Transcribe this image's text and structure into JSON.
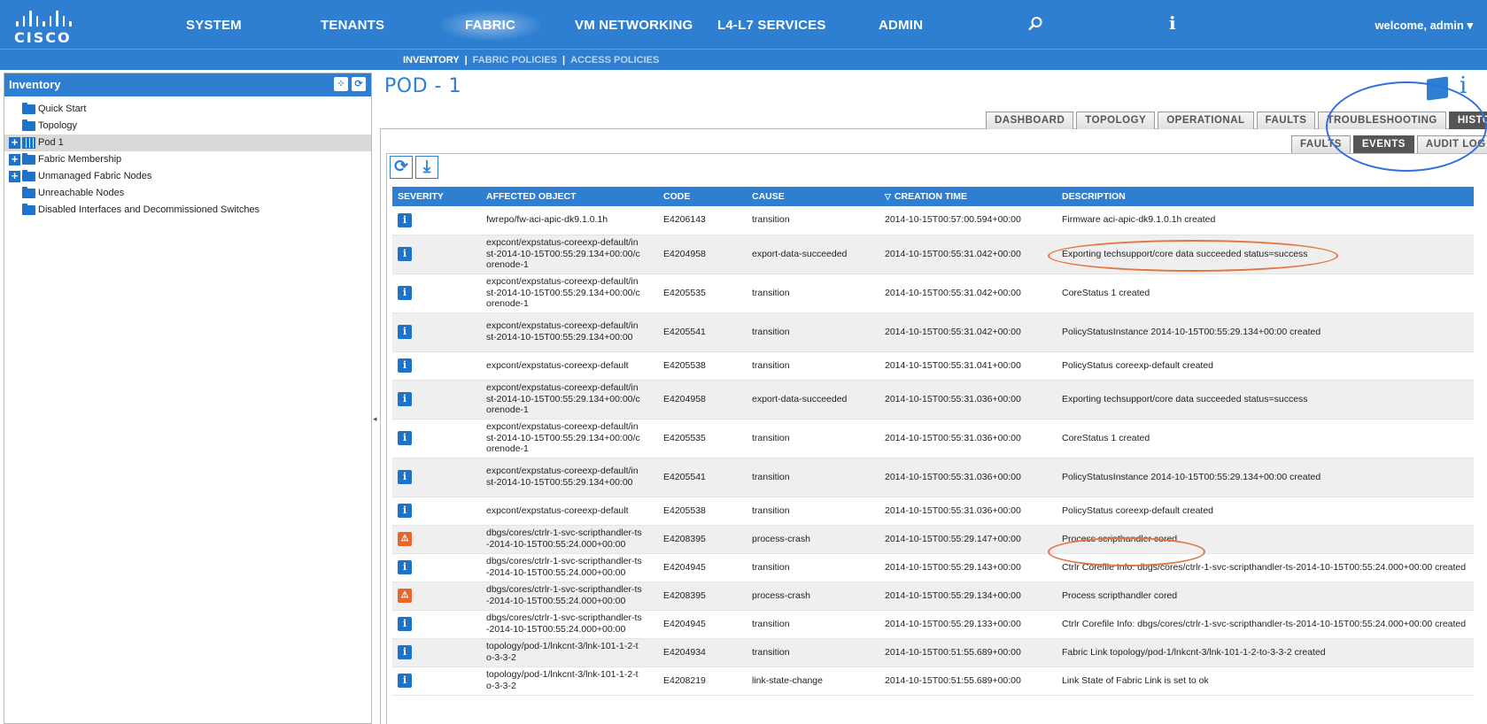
{
  "top_nav": {
    "logo_text": "CISCO",
    "items": [
      "SYSTEM",
      "TENANTS",
      "FABRIC",
      "VM NETWORKING",
      "L4-L7 SERVICES",
      "ADMIN"
    ],
    "active": "FABRIC",
    "welcome": "welcome, admin ▾"
  },
  "sub_nav": {
    "items": [
      "INVENTORY",
      "FABRIC POLICIES",
      "ACCESS POLICIES"
    ],
    "active": "INVENTORY"
  },
  "left_panel": {
    "title": "Inventory",
    "tree": [
      {
        "label": "Quick Start"
      },
      {
        "label": "Topology"
      },
      {
        "label": "Pod 1"
      },
      {
        "label": "Fabric Membership"
      },
      {
        "label": "Unmanaged Fabric Nodes"
      },
      {
        "label": "Unreachable Nodes"
      },
      {
        "label": "Disabled Interfaces and Decommissioned Switches"
      }
    ]
  },
  "main": {
    "title": "POD - 1",
    "tabs": [
      "DASHBOARD",
      "TOPOLOGY",
      "OPERATIONAL",
      "FAULTS",
      "TROUBLESHOOTING",
      "HISTORY"
    ],
    "active_tab": "HISTORY",
    "subtabs": [
      "FAULTS",
      "EVENTS",
      "AUDIT LOG"
    ],
    "active_subtab": "EVENTS"
  },
  "table": {
    "columns": [
      "SEVERITY",
      "AFFECTED OBJECT",
      "CODE",
      "CAUSE",
      "CREATION TIME",
      "DESCRIPTION"
    ],
    "sorted_column": "CREATION TIME",
    "rows": [
      {
        "severity": "info",
        "object": "fwrepo/fw-aci-apic-dk9.1.0.1h",
        "code": "E4206143",
        "cause": "transition",
        "time": "2014-10-15T00:57:00.594+00:00",
        "description": "Firmware aci-apic-dk9.1.0.1h created"
      },
      {
        "severity": "info",
        "object": "expcont/expstatus-coreexp-default/inst-2014-10-15T00:55:29.134+00:00/corenode-1",
        "code": "E4204958",
        "cause": "export-data-succeeded",
        "time": "2014-10-15T00:55:31.042+00:00",
        "description": "Exporting techsupport/core data succeeded status=success"
      },
      {
        "severity": "info",
        "object": "expcont/expstatus-coreexp-default/inst-2014-10-15T00:55:29.134+00:00/corenode-1",
        "code": "E4205535",
        "cause": "transition",
        "time": "2014-10-15T00:55:31.042+00:00",
        "description": "CoreStatus 1 created"
      },
      {
        "severity": "info",
        "object": "expcont/expstatus-coreexp-default/inst-2014-10-15T00:55:29.134+00:00",
        "code": "E4205541",
        "cause": "transition",
        "time": "2014-10-15T00:55:31.042+00:00",
        "description": "PolicyStatusInstance 2014-10-15T00:55:29.134+00:00 created"
      },
      {
        "severity": "info",
        "object": "expcont/expstatus-coreexp-default",
        "code": "E4205538",
        "cause": "transition",
        "time": "2014-10-15T00:55:31.041+00:00",
        "description": "PolicyStatus coreexp-default created"
      },
      {
        "severity": "info",
        "object": "expcont/expstatus-coreexp-default/inst-2014-10-15T00:55:29.134+00:00/corenode-1",
        "code": "E4204958",
        "cause": "export-data-succeeded",
        "time": "2014-10-15T00:55:31.036+00:00",
        "description": "Exporting techsupport/core data succeeded status=success"
      },
      {
        "severity": "info",
        "object": "expcont/expstatus-coreexp-default/inst-2014-10-15T00:55:29.134+00:00/corenode-1",
        "code": "E4205535",
        "cause": "transition",
        "time": "2014-10-15T00:55:31.036+00:00",
        "description": "CoreStatus 1 created"
      },
      {
        "severity": "info",
        "object": "expcont/expstatus-coreexp-default/inst-2014-10-15T00:55:29.134+00:00",
        "code": "E4205541",
        "cause": "transition",
        "time": "2014-10-15T00:55:31.036+00:00",
        "description": "PolicyStatusInstance 2014-10-15T00:55:29.134+00:00 created"
      },
      {
        "severity": "info",
        "object": "expcont/expstatus-coreexp-default",
        "code": "E4205538",
        "cause": "transition",
        "time": "2014-10-15T00:55:31.036+00:00",
        "description": "PolicyStatus coreexp-default created"
      },
      {
        "severity": "warning",
        "object": "dbgs/cores/ctrlr-1-svc-scripthandler-ts-2014-10-15T00:55:24.000+00:00",
        "code": "E4208395",
        "cause": "process-crash",
        "time": "2014-10-15T00:55:29.147+00:00",
        "description": "Process scripthandler cored"
      },
      {
        "severity": "info",
        "object": "dbgs/cores/ctrlr-1-svc-scripthandler-ts-2014-10-15T00:55:24.000+00:00",
        "code": "E4204945",
        "cause": "transition",
        "time": "2014-10-15T00:55:29.143+00:00",
        "description": "Ctrlr Corefile Info: dbgs/cores/ctrlr-1-svc-scripthandler-ts-2014-10-15T00:55:24.000+00:00 created"
      },
      {
        "severity": "warning",
        "object": "dbgs/cores/ctrlr-1-svc-scripthandler-ts-2014-10-15T00:55:24.000+00:00",
        "code": "E4208395",
        "cause": "process-crash",
        "time": "2014-10-15T00:55:29.134+00:00",
        "description": "Process scripthandler cored"
      },
      {
        "severity": "info",
        "object": "dbgs/cores/ctrlr-1-svc-scripthandler-ts-2014-10-15T00:55:24.000+00:00",
        "code": "E4204945",
        "cause": "transition",
        "time": "2014-10-15T00:55:29.133+00:00",
        "description": "Ctrlr Corefile Info: dbgs/cores/ctrlr-1-svc-scripthandler-ts-2014-10-15T00:55:24.000+00:00 created"
      },
      {
        "severity": "info",
        "object": "topology/pod-1/lnkcnt-3/lnk-101-1-2-to-3-3-2",
        "code": "E4204934",
        "cause": "transition",
        "time": "2014-10-15T00:51:55.689+00:00",
        "description": "Fabric Link topology/pod-1/lnkcnt-3/lnk-101-1-2-to-3-3-2 created"
      },
      {
        "severity": "info",
        "object": "topology/pod-1/lnkcnt-3/lnk-101-1-2-to-3-3-2",
        "code": "E4208219",
        "cause": "link-state-change",
        "time": "2014-10-15T00:51:55.689+00:00",
        "description": "Link State of Fabric Link is set to ok"
      }
    ]
  },
  "colors": {
    "brand_blue": "#2e7fd1",
    "info_icon": "#1d72c9",
    "warning_icon": "#e8652b",
    "annotation_blue": "#2f6fe0",
    "annotation_orange": "#e5743d"
  }
}
